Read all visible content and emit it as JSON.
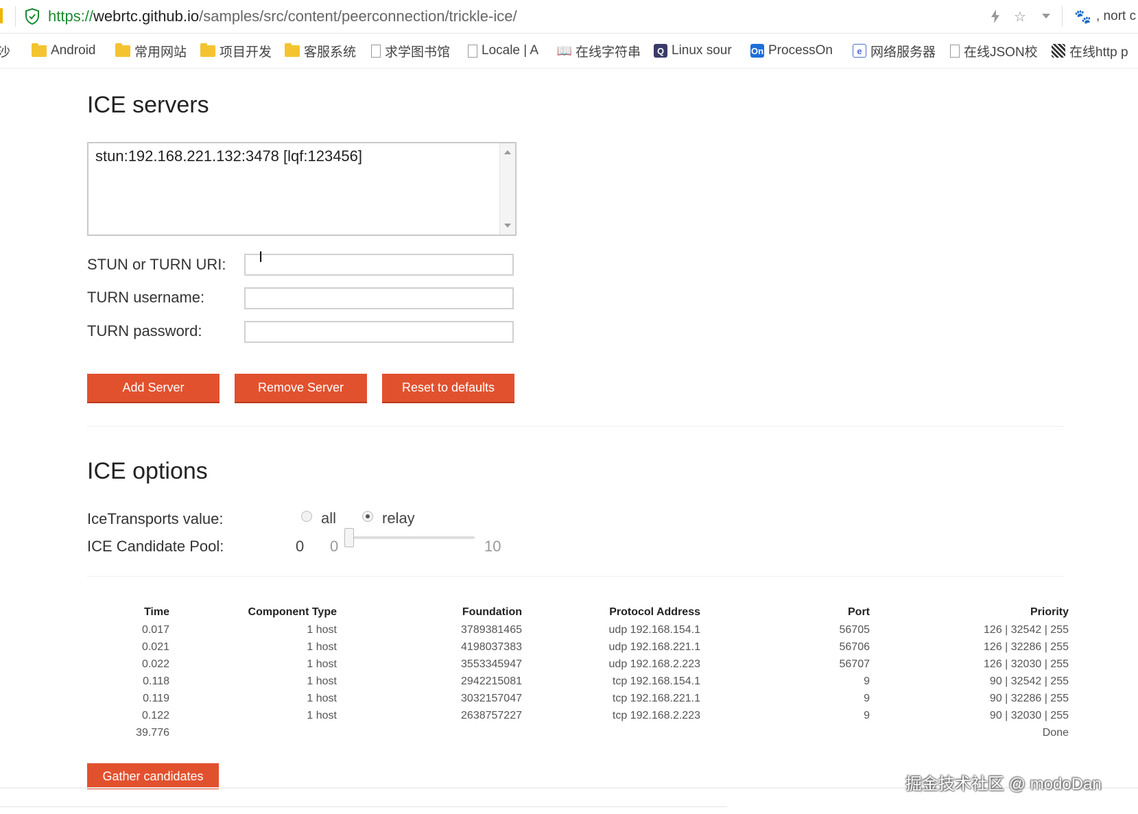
{
  "browser": {
    "url_scheme": "https://",
    "url_host": "webrtc.github.io",
    "url_path": "/samples/src/content/peerconnection/trickle-ice/",
    "profile_text": ", nort c"
  },
  "bookmarks": [
    {
      "label": "沙",
      "icon": "none"
    },
    {
      "label": "Android",
      "icon": "folder-icon"
    },
    {
      "label": "常用网站",
      "icon": "folder-icon"
    },
    {
      "label": "项目开发",
      "icon": "folder-icon"
    },
    {
      "label": "客服系统",
      "icon": "folder-icon"
    },
    {
      "label": "求学图书馆",
      "icon": "page-icon"
    },
    {
      "label": "Locale | A",
      "icon": "page-icon"
    },
    {
      "label": "在线字符串",
      "icon": "book-icon"
    },
    {
      "label": "Linux sour",
      "icon": "linux-icon"
    },
    {
      "label": "ProcessOn",
      "icon": "processon-icon"
    },
    {
      "label": "网络服务器",
      "icon": "server-icon"
    },
    {
      "label": "在线JSON校",
      "icon": "page-icon"
    },
    {
      "label": "在线http p",
      "icon": "qr-icon"
    }
  ],
  "ice_servers": {
    "heading": "ICE servers",
    "list_text": "stun:192.168.221.132:3478 [lqf:123456]",
    "uri_label": "STUN or TURN URI:",
    "username_label": "TURN username:",
    "password_label": "TURN password:",
    "uri_value": "",
    "username_value": "",
    "password_value": "",
    "add_label": "Add Server",
    "remove_label": "Remove Server",
    "reset_label": "Reset to defaults"
  },
  "ice_options": {
    "heading": "ICE options",
    "transports_label": "IceTransports value:",
    "option_all": "all",
    "option_relay": "relay",
    "selected": "relay",
    "pool_label": "ICE Candidate Pool:",
    "pool_value": "0",
    "pool_min": "0",
    "pool_max": "10",
    "pool_level": 0
  },
  "candidates": {
    "headers": [
      "Time",
      "Component Type",
      "Foundation",
      "Protocol Address",
      "Port",
      "Priority"
    ],
    "rows": [
      [
        "0.017",
        "1 host",
        "3789381465",
        "udp 192.168.154.1",
        "56705",
        "126 | 32542 | 255"
      ],
      [
        "0.021",
        "1 host",
        "4198037383",
        "udp 192.168.221.1",
        "56706",
        "126 | 32286 | 255"
      ],
      [
        "0.022",
        "1 host",
        "3553345947",
        "udp 192.168.2.223",
        "56707",
        "126 | 32030 | 255"
      ],
      [
        "0.118",
        "1 host",
        "2942215081",
        "tcp 192.168.154.1",
        "9",
        "90 | 32542 | 255"
      ],
      [
        "0.119",
        "1 host",
        "3032157047",
        "tcp 192.168.221.1",
        "9",
        "90 | 32286 | 255"
      ],
      [
        "0.122",
        "1 host",
        "2638757227",
        "tcp 192.168.2.223",
        "9",
        "90 | 32030 | 255"
      ],
      [
        "39.776",
        "",
        "",
        "",
        "",
        "Done"
      ]
    ],
    "gather_label": "Gather candidates"
  },
  "watermark": "掘金技术社区 @ modoDan",
  "colors": {
    "accent": "#e2512e",
    "secure": "#1a8a2f"
  }
}
